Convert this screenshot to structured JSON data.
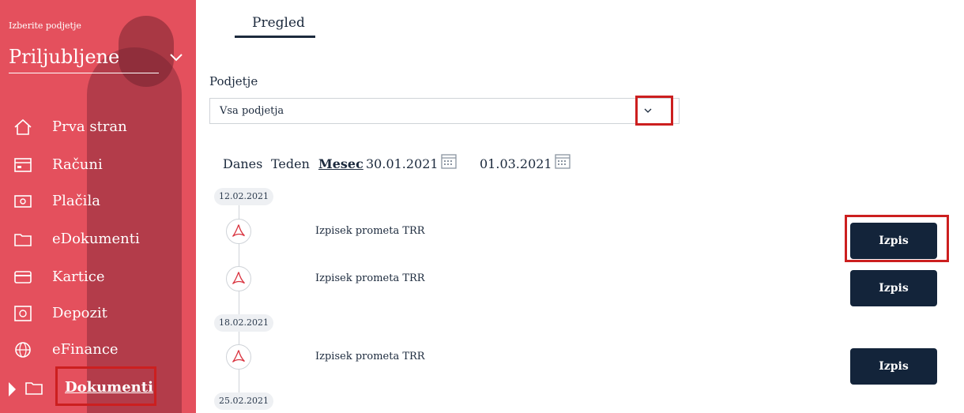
{
  "sidebar": {
    "company_label": "Izberite podjetje",
    "company_value": "Priljubljene",
    "items": [
      {
        "label": "Prva stran",
        "icon": "home-icon"
      },
      {
        "label": "Računi",
        "icon": "wallet-icon"
      },
      {
        "label": "Plačila",
        "icon": "money-icon"
      },
      {
        "label": "eDokumenti",
        "icon": "folder-icon"
      },
      {
        "label": "Kartice",
        "icon": "card-icon"
      },
      {
        "label": "Depozit",
        "icon": "safe-icon"
      },
      {
        "label": "eFinance",
        "icon": "globe-icon"
      },
      {
        "label": "Dokumenti",
        "icon": "folder-icon"
      }
    ]
  },
  "tab": {
    "label": "Pregled"
  },
  "company_field": {
    "label": "Podjetje",
    "value": "Vsa podjetja"
  },
  "filters": {
    "today": "Danes",
    "week": "Teden",
    "month": "Mesec",
    "from": "30.01.2021",
    "to": "01.03.2021"
  },
  "timeline": {
    "dates": [
      "12.02.2021",
      "18.02.2021",
      "25.02.2021"
    ],
    "docs": [
      {
        "name": "Izpisek prometa TRR",
        "action": "Izpis"
      },
      {
        "name": "Izpisek prometa TRR",
        "action": "Izpis"
      },
      {
        "name": "Izpisek prometa TRR",
        "action": "Izpis"
      }
    ]
  },
  "colors": {
    "sidebar": "#e4505d",
    "button": "#13243a",
    "highlight": "#cc1f1f"
  }
}
